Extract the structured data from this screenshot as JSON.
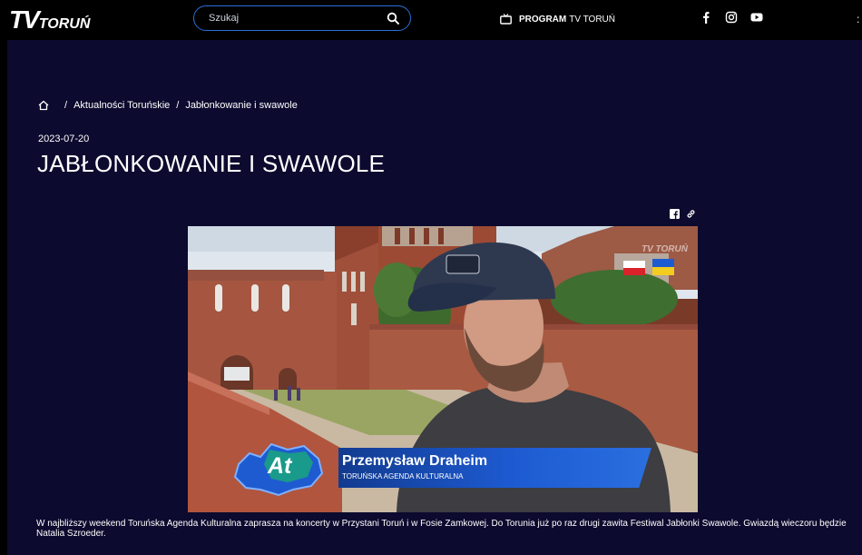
{
  "header": {
    "logo_tv": "TV",
    "logo_city": "TORUŃ",
    "search_placeholder": "Szukaj",
    "program_bold": "PROGRAM",
    "program_rest": "TV TORUŃ",
    "socials": [
      "facebook-icon",
      "instagram-icon",
      "youtube-icon"
    ]
  },
  "breadcrumb": {
    "items": [
      "Aktualności Toruńskie",
      "Jabłonkowanie i swawole"
    ],
    "separator": "/"
  },
  "article": {
    "date": "2023-07-20",
    "title": "JABŁONKOWANIE I SWAWOLE",
    "description": "W najbliższy weekend Toruńska Agenda Kulturalna zaprasza na koncerty w Przystani Toruń i w Fosie Zamkowej. Do Torunia już po raz drugi zawita Festiwal Jabłonki Swawole. Gwiazdą wieczoru będzie Natalia Szroeder."
  },
  "video": {
    "badge": "At",
    "person_name": "Przemysław Draheim",
    "person_org": "TORUŃSKA AGENDA KULTURALNA",
    "watermark": "TV TORUŃ"
  },
  "colors": {
    "background": "#0c0a2e",
    "accent": "#2a6fd6",
    "lower_third": "#1d5ad1"
  }
}
